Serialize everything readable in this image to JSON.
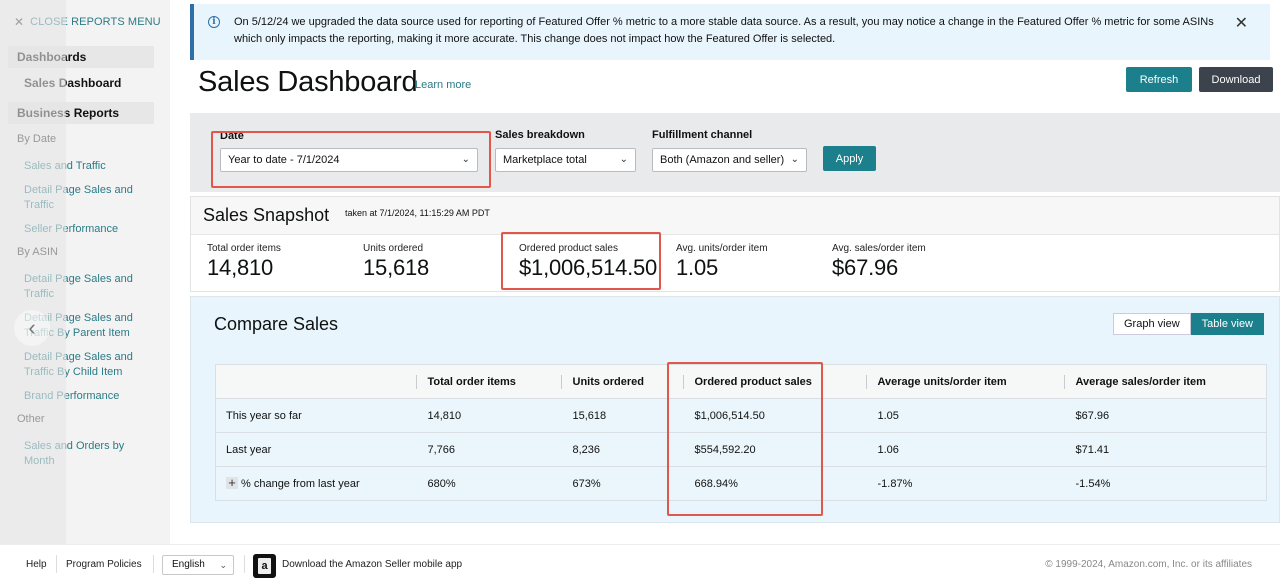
{
  "sidebar": {
    "close_label": "CLOSE REPORTS MENU",
    "dashboards_heading": "Dashboards",
    "active_item": "Sales Dashboard",
    "business_reports_heading": "Business Reports",
    "groups": [
      {
        "label": "By Date",
        "items": [
          "Sales and Traffic",
          "Detail Page Sales and Traffic",
          "Seller Performance"
        ]
      },
      {
        "label": "By ASIN",
        "items": [
          "Detail Page Sales and Traffic",
          "Detail Page Sales and Traffic By Parent Item",
          "Detail Page Sales and Traffic By Child Item",
          "Brand Performance"
        ]
      },
      {
        "label": "Other",
        "items": [
          "Sales and Orders by Month"
        ]
      }
    ]
  },
  "banner": {
    "message": "On 5/12/24 we upgraded the data source used for reporting of Featured Offer % metric to a more stable data source. As a result, you may notice a change in the Featured Offer % metric for some ASINs which only impacts the reporting, making it more accurate. This change does not impact how the Featured Offer is selected."
  },
  "header": {
    "title": "Sales Dashboard",
    "learn_more": "Learn more",
    "refresh_label": "Refresh",
    "download_label": "Download"
  },
  "filters": {
    "date_label": "Date",
    "date_value": "Year to date - 7/1/2024",
    "breakdown_label": "Sales breakdown",
    "breakdown_value": "Marketplace total",
    "channel_label": "Fulfillment channel",
    "channel_value": "Both (Amazon and seller)",
    "apply_label": "Apply"
  },
  "snapshot": {
    "title": "Sales Snapshot",
    "timestamp": "taken at 7/1/2024, 11:15:29 AM PDT",
    "metrics": [
      {
        "label": "Total order items",
        "value": "14,810"
      },
      {
        "label": "Units ordered",
        "value": "15,618"
      },
      {
        "label": "Ordered product sales",
        "value": "$1,006,514.50"
      },
      {
        "label": "Avg. units/order item",
        "value": "1.05"
      },
      {
        "label": "Avg. sales/order item",
        "value": "$67.96"
      }
    ]
  },
  "compare": {
    "title": "Compare Sales",
    "graph_view": "Graph view",
    "table_view": "Table view",
    "columns": [
      "",
      "Total order items",
      "Units ordered",
      "Ordered product sales",
      "Average units/order item",
      "Average sales/order item"
    ],
    "rows": [
      {
        "label": "This year so far",
        "cells": [
          "14,810",
          "15,618",
          "$1,006,514.50",
          "1.05",
          "$67.96"
        ]
      },
      {
        "label": "Last year",
        "cells": [
          "7,766",
          "8,236",
          "$554,592.20",
          "1.06",
          "$71.41"
        ]
      },
      {
        "label": "% change from last year",
        "expand": "+",
        "cells": [
          "680%",
          "673%",
          "668.94%",
          "-1.87%",
          "-1.54%"
        ]
      }
    ]
  },
  "colors": {
    "accent": "#1b7f8c",
    "link": "#2b7b86",
    "positive": "#2a8c2a",
    "negative": "#cc2229",
    "highlight": "#e2574c"
  },
  "footer": {
    "help": "Help",
    "program_policies": "Program Policies",
    "language": "English",
    "app_promo": "Download the Amazon Seller mobile app",
    "copyright": "© 1999-2024, Amazon.com, Inc. or its affiliates"
  }
}
